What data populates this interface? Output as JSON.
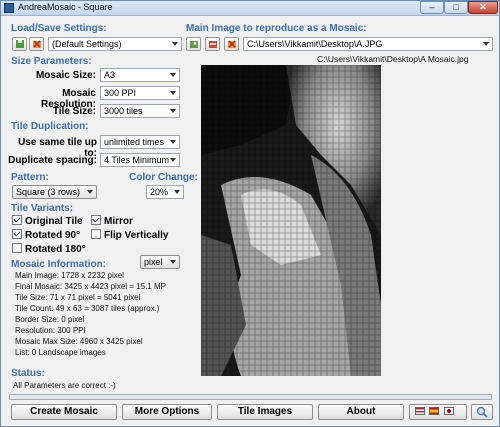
{
  "window": {
    "title": "AndreaMosaic - Square",
    "min": "–",
    "max": "□",
    "close": "✕"
  },
  "load_save": {
    "heading": "Load/Save Settings:",
    "preset": "(Default Settings)"
  },
  "main_image": {
    "heading": "Main Image to reproduce as a Mosaic:",
    "path": "C:\\Users\\Vikkamit\\Desktop\\A.JPG",
    "output_path": "C:\\Users\\Vikkamit\\Desktop\\A Mosaic.jpg"
  },
  "size_params": {
    "heading": "Size Parameters:",
    "mosaic_size_label": "Mosaic Size:",
    "mosaic_size": "A3",
    "resolution_label": "Mosaic Resolution:",
    "resolution": "300 PPI",
    "tile_size_label": "Tile Size:",
    "tile_size": "3000 tiles"
  },
  "tile_dup": {
    "heading": "Tile Duplication:",
    "use_same_label": "Use same tile up to:",
    "use_same": "unlimited times",
    "spacing_label": "Duplicate spacing:",
    "spacing": "4 Tiles Minimum"
  },
  "pattern": {
    "heading": "Pattern:",
    "value": "Square (3 rows)"
  },
  "color_change": {
    "heading": "Color Change:",
    "value": "20%"
  },
  "tile_variants": {
    "heading": "Tile Variants:",
    "original": "Original Tile",
    "mirror": "Mirror",
    "rot90": "Rotated 90°",
    "flipv": "Flip Vertically",
    "rot180": "Rotated 180°",
    "checked": {
      "original": true,
      "mirror": true,
      "rot90": true,
      "flipv": false,
      "rot180": false
    }
  },
  "mosaic_info": {
    "heading": "Mosaic Information:",
    "unit": "pixel",
    "lines": [
      "Main Image: 1728 x 2232 pixel",
      "Final Mosaic: 3425 x 4423 pixel = 15.1 MP",
      "Tile Size: 71 x 71 pixel = 5041 pixel",
      "Tile Count: 49 x 63 = 3087 tiles (approx.)",
      "Border Size: 0 pixel",
      "Resolution: 300 PPI",
      "Mosaic Max Size: 4960 x 3425 pixel",
      "List: 0 Landscape images"
    ]
  },
  "status": {
    "heading": "Status:",
    "text": "All Parameters are correct :-)"
  },
  "progress": 0.0,
  "buttons": {
    "create": "Create Mosaic",
    "more": "More Options",
    "tiles": "Tile Images",
    "about": "About"
  },
  "colors": {
    "section": "#3d6eb5",
    "accent": "#2d5c9a"
  }
}
